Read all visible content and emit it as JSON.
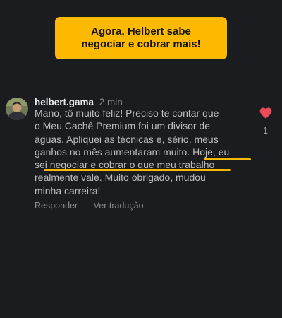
{
  "banner": {
    "line1": "Agora, Helbert sabe",
    "line2": "negociar e cobrar mais!"
  },
  "comment": {
    "username": "helbert.gama",
    "time": "2 min",
    "lines": [
      "Mano, tô muito feliz! Preciso te contar que",
      "o Meu Cachê Premium foi um divisor de",
      "águas. Apliquei as técnicas e, sério, meus",
      "ganhos no mês aumentaram muito. Hoje, eu",
      "sei negociar e cobrar o que meu trabalho",
      "realmente vale. Muito obrigado, mudou",
      "minha carreira!"
    ],
    "reply_label": "Responder",
    "translate_label": "Ver tradução",
    "like_count": "1"
  },
  "colors": {
    "accent": "#fcb900",
    "background": "#1a1c20",
    "heart": "#ed4956"
  },
  "icons": {
    "like": "heart-icon",
    "avatar": "avatar"
  }
}
